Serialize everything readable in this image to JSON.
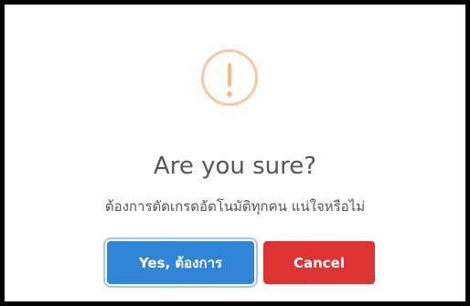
{
  "dialog": {
    "icon": "warning-icon",
    "title": "Are you sure?",
    "message": "ต้องการตัดเกรดอัตโนมัติทุกคน แน่ใจหรือไม่",
    "confirm_label": "Yes, ต้องการ",
    "cancel_label": "Cancel"
  },
  "colors": {
    "icon": "#f8bb86",
    "confirm": "#3085d6",
    "cancel": "#dd3333",
    "title": "#575757"
  }
}
